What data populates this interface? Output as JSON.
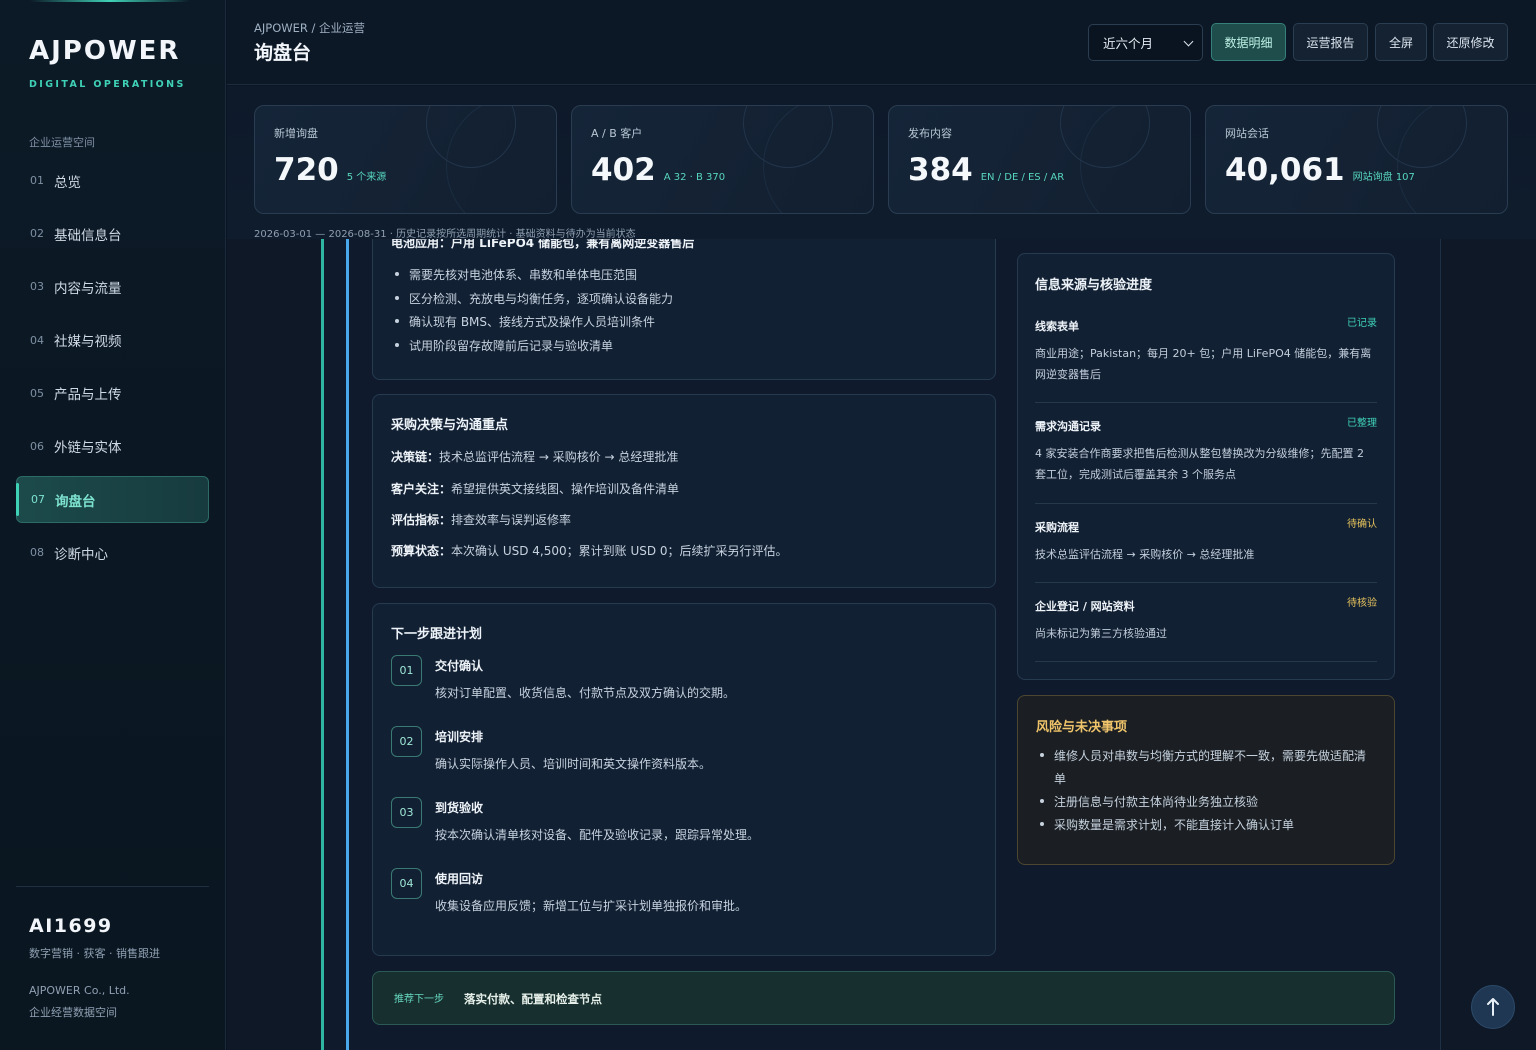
{
  "sidebar": {
    "brand": "AJPOWER",
    "brand_sub": "DIGITAL OPERATIONS",
    "space_label": "企业运营空间",
    "items": [
      {
        "num": "01",
        "label": "总览"
      },
      {
        "num": "02",
        "label": "基础信息台"
      },
      {
        "num": "03",
        "label": "内容与流量"
      },
      {
        "num": "04",
        "label": "社媒与视频"
      },
      {
        "num": "05",
        "label": "产品与上传"
      },
      {
        "num": "06",
        "label": "外链与实体"
      },
      {
        "num": "07",
        "label": "询盘台"
      },
      {
        "num": "08",
        "label": "诊断中心"
      }
    ],
    "footer": {
      "code": "AI1699",
      "tagline": "数字营销 · 获客 · 销售跟进",
      "company": "AJPOWER Co., Ltd.",
      "space": "企业经营数据空间"
    }
  },
  "header": {
    "breadcrumb": "AJPOWER / 企业运营",
    "title": "询盘台",
    "period": "近六个月",
    "buttons": {
      "detail": "数据明细",
      "report": "运营报告",
      "fullscreen": "全屏",
      "restore": "还原修改"
    }
  },
  "stats": [
    {
      "label": "新增询盘",
      "value": "720",
      "note": "5 个来源"
    },
    {
      "label": "A / B 客户",
      "value": "402",
      "note": "A 32 · B 370"
    },
    {
      "label": "发布内容",
      "value": "384",
      "note": "EN / DE / ES / AR"
    },
    {
      "label": "网站会话",
      "value": "40,061",
      "note": "网站询盘 107"
    }
  ],
  "range_note": "2026-03-01 — 2026-08-31 · 历史记录按所选周期统计 · 基础资料与待办为当前状态",
  "requirements": {
    "cut_line": "电池应用：户用 LiFePO4 储能包，兼有离网逆变器售后",
    "bullets": [
      "需要先核对电池体系、串数和单体电压范围",
      "区分检测、充放电与均衡任务，逐项确认设备能力",
      "确认现有 BMS、接线方式及操作人员培训条件",
      "试用阶段留存故障前后记录与验收清单"
    ]
  },
  "decision": {
    "title": "采购决策与沟通重点",
    "rows": [
      {
        "key": "决策链：",
        "value": "技术总监评估流程 → 采购核价 → 总经理批准"
      },
      {
        "key": "客户关注：",
        "value": "希望提供英文接线图、操作培训及备件清单"
      },
      {
        "key": "评估指标：",
        "value": "排查效率与误判返修率"
      },
      {
        "key": "预算状态：",
        "value": "本次确认 USD 4,500；累计到账 USD 0；后续扩采另行评估。"
      }
    ]
  },
  "plan": {
    "title": "下一步跟进计划",
    "steps": [
      {
        "num": "01",
        "title": "交付确认",
        "desc": "核对订单配置、收货信息、付款节点及双方确认的交期。"
      },
      {
        "num": "02",
        "title": "培训安排",
        "desc": "确认实际操作人员、培训时间和英文操作资料版本。"
      },
      {
        "num": "03",
        "title": "到货验收",
        "desc": "按本次确认清单核对设备、配件及验收记录，跟踪异常处理。"
      },
      {
        "num": "04",
        "title": "使用回访",
        "desc": "收集设备应用反馈；新增工位与扩采计划单独报价和审批。"
      }
    ]
  },
  "sources": {
    "title": "信息来源与核验进度",
    "items": [
      {
        "name": "线索表单",
        "state": "已记录",
        "desc": "商业用途；Pakistan；每月 20+ 包；户用 LiFePO4 储能包，兼有离网逆变器售后"
      },
      {
        "name": "需求沟通记录",
        "state": "已整理",
        "desc": "4 家安装合作商要求把售后检测从整包替换改为分级维修；先配置 2 套工位，完成测试后覆盖其余 3 个服务点"
      },
      {
        "name": "采购流程",
        "state": "待确认",
        "desc": "技术总监评估流程 → 采购核价 → 总经理批准"
      },
      {
        "name": "企业登记 / 网站资料",
        "state": "待核验",
        "desc": "尚未标记为第三方核验通过"
      }
    ]
  },
  "risk": {
    "title": "风险与未决事项",
    "bullets": [
      "维修人员对串数与均衡方式的理解不一致，需要先做适配清单",
      "注册信息与付款主体尚待业务独立核验",
      "采购数量是需求计划，不能直接计入确认订单"
    ]
  },
  "next": {
    "tag": "推荐下一步",
    "text": "落实付款、配置和检查节点"
  },
  "colors": {
    "accent": "#3fd1b6",
    "rail_blue": "#4aa8ea",
    "warning": "#f0c46a",
    "pending": "#e6c35c"
  }
}
